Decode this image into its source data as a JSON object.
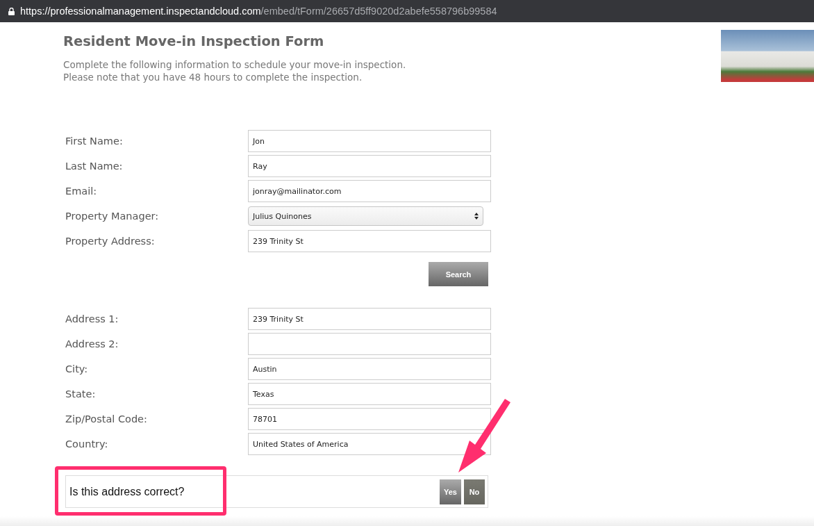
{
  "address_bar": {
    "url_host": "https://professionalmanagement.inspectandcloud.com",
    "url_path": "/embed/tForm/26657d5ff9020d2abefe558796b99584"
  },
  "form": {
    "title": "Resident Move-in Inspection Form",
    "intro": [
      "Complete the following information to schedule your move-in inspection.",
      "Please note that you have 48 hours to complete the inspection."
    ],
    "contact_fields": [
      {
        "label": "First Name:",
        "kind": "text",
        "value": "Jon"
      },
      {
        "label": "Last Name:",
        "kind": "text",
        "value": "Ray"
      },
      {
        "label": "Email:",
        "kind": "text",
        "value": "jonray@mailinator.com"
      },
      {
        "label": "Property Manager:",
        "kind": "select",
        "value": "Julius Quinones"
      },
      {
        "label": "Property Address:",
        "kind": "text",
        "value": "239 Trinity St"
      }
    ],
    "search_button": "Search",
    "address_fields": [
      {
        "label": "Address 1:",
        "kind": "text",
        "value": "239 Trinity St"
      },
      {
        "label": "Address 2:",
        "kind": "text"
      },
      {
        "label": "City:",
        "kind": "text",
        "value": "Austin"
      },
      {
        "label": "State:",
        "kind": "text",
        "value": "Texas"
      },
      {
        "label": "Zip/Postal Code:",
        "kind": "text",
        "value": "78701"
      },
      {
        "label": "Country:",
        "kind": "text",
        "value": "United States of America"
      }
    ],
    "confirm": {
      "question": "Is this address correct?",
      "buttons": [
        {
          "label": "Yes",
          "kind": "light"
        },
        {
          "label": "No",
          "kind": "dark"
        }
      ]
    }
  }
}
